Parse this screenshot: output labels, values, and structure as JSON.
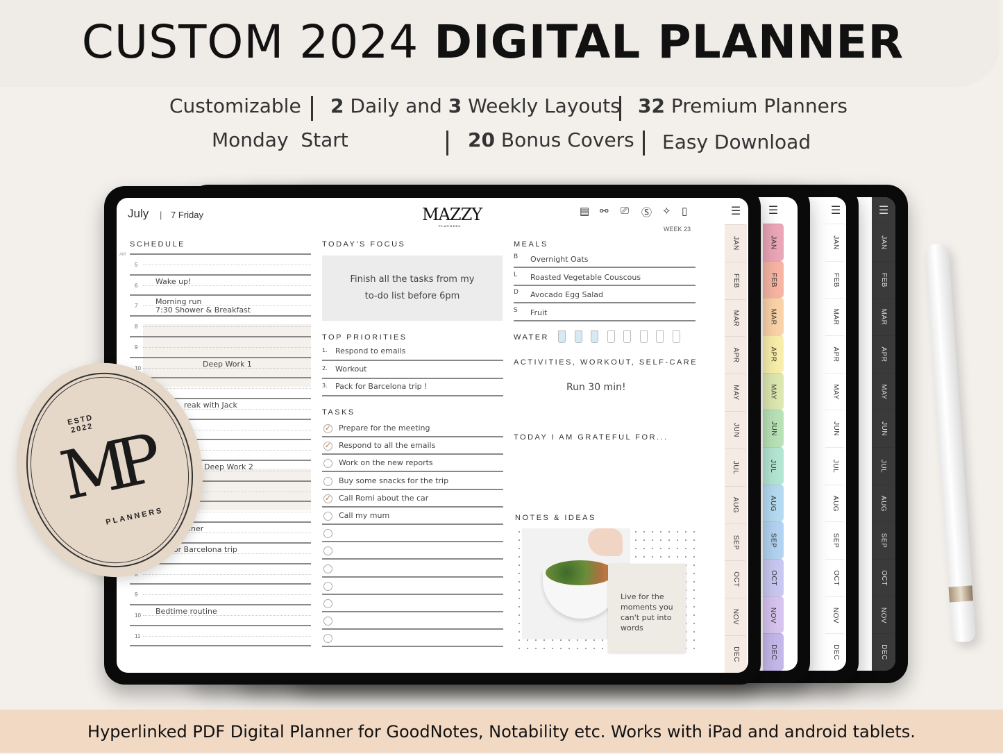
{
  "banner": {
    "title_light": "CUSTOM 2024",
    "title_bold": "DIGITAL PLANNER",
    "features": [
      {
        "text": "Customizable"
      },
      {
        "bold1": "2",
        "text1": " Daily and ",
        "bold2": "3",
        "text2": " Weekly Layouts"
      },
      {
        "bold": "32",
        "text": " Premium Planners"
      },
      {
        "text": "Monday  Start"
      },
      {
        "bold": "20",
        "text": " Bonus Covers"
      },
      {
        "text": "Easy Download"
      }
    ],
    "footer": "Hyperlinked PDF Digital Planner for GoodNotes, Notability etc. Works with iPad and android tablets."
  },
  "page": {
    "month": "July",
    "day": "7 Friday",
    "logo": "MAZZY",
    "logo_sub": "PLANNERS",
    "week": "WEEK 23",
    "toolbar_icons": [
      "clipboard-icon",
      "dumbbell-icon",
      "camera-icon",
      "dollar-icon",
      "sparkle-icon",
      "page-icon"
    ],
    "schedule": {
      "label": "SCHEDULE",
      "am": "AM",
      "hours": [
        "5",
        "6",
        "7",
        "8",
        "9",
        "10",
        "11",
        "12",
        "1",
        "2",
        "3",
        "4",
        "5",
        "6",
        "7",
        "8",
        "9",
        "10",
        "11"
      ],
      "entries": [
        {
          "hour_index": 1,
          "text": "Wake up!"
        },
        {
          "hour_index": 2,
          "text": "Morning run"
        },
        {
          "hour_index": 2,
          "text": "7:30  Shower & Breakfast"
        },
        {
          "hour_index": 5,
          "text": "Deep Work 1"
        },
        {
          "hour_index": 7,
          "text": "reak with Jack"
        },
        {
          "hour_index": 10,
          "text": "Deep Work 2"
        },
        {
          "hour_index": 13,
          "text": "nner"
        },
        {
          "hour_index": 14,
          "text": "for Barcelona trip"
        },
        {
          "hour_index": 17,
          "text": "Bedtime routine"
        }
      ]
    },
    "focus": {
      "label": "TODAY'S FOCUS",
      "text": "Finish all the tasks from my to-do list before 6pm"
    },
    "priorities": {
      "label": "TOP PRIORITIES",
      "items": [
        "Respond to emails",
        "Workout",
        "Pack for Barcelona trip !"
      ]
    },
    "tasks": {
      "label": "TASKS",
      "items": [
        {
          "text": "Prepare for the meeting",
          "done": true
        },
        {
          "text": "Respond to all the emails",
          "done": true
        },
        {
          "text": "Work on the new reports",
          "done": false
        },
        {
          "text": "Buy some snacks for the trip",
          "done": false
        },
        {
          "text": "Call Romi about the car",
          "done": true
        },
        {
          "text": "Call my mum",
          "done": false
        },
        {
          "text": "",
          "done": false
        },
        {
          "text": "",
          "done": false
        },
        {
          "text": "",
          "done": false
        },
        {
          "text": "",
          "done": false
        },
        {
          "text": "",
          "done": false
        },
        {
          "text": "",
          "done": false
        },
        {
          "text": "",
          "done": false
        }
      ]
    },
    "meals": {
      "label": "MEALS",
      "items": [
        {
          "key": "B",
          "text": "Overnight Oats"
        },
        {
          "key": "L",
          "text": "Roasted Vegetable Couscous"
        },
        {
          "key": "D",
          "text": "Avocado Egg Salad"
        },
        {
          "key": "S",
          "text": "Fruit"
        }
      ]
    },
    "water": {
      "label": "WATER",
      "glasses": 8,
      "filled": 3,
      "fill_color": "#d6e9f5"
    },
    "activities": {
      "label": "ACTIVITIES, WORKOUT, SELF-CARE",
      "text": "Run 30 min!"
    },
    "grateful": {
      "label": "TODAY I AM GRATEFUL FOR..."
    },
    "notes": {
      "label": "NOTES & IDEAS",
      "quote": "Live for the moments you can't put into words"
    }
  },
  "months": [
    "JAN",
    "FEB",
    "MAR",
    "APR",
    "MAY",
    "JUN",
    "JUL",
    "AUG",
    "SEP",
    "OCT",
    "NOV",
    "DEC"
  ],
  "tab_themes": {
    "neutral": [
      "#f5ebe4"
    ],
    "rainbow": [
      "#eba6b8",
      "#f8b5a3",
      "#fbd3a8",
      "#f9efab",
      "#dde8b0",
      "#b9e3b6",
      "#b4e6d4",
      "#b5dbf2",
      "#b3d3f2",
      "#c9c8f2",
      "#d8c4f0",
      "#c4b8ea"
    ],
    "white": [
      "#ffffff"
    ],
    "dark": [
      "#3a3a3a"
    ]
  },
  "stamp": {
    "estd": "ESTD",
    "year": "2022",
    "mono": "MP",
    "name": "PLANNERS",
    "color": "#e6d8c9"
  }
}
